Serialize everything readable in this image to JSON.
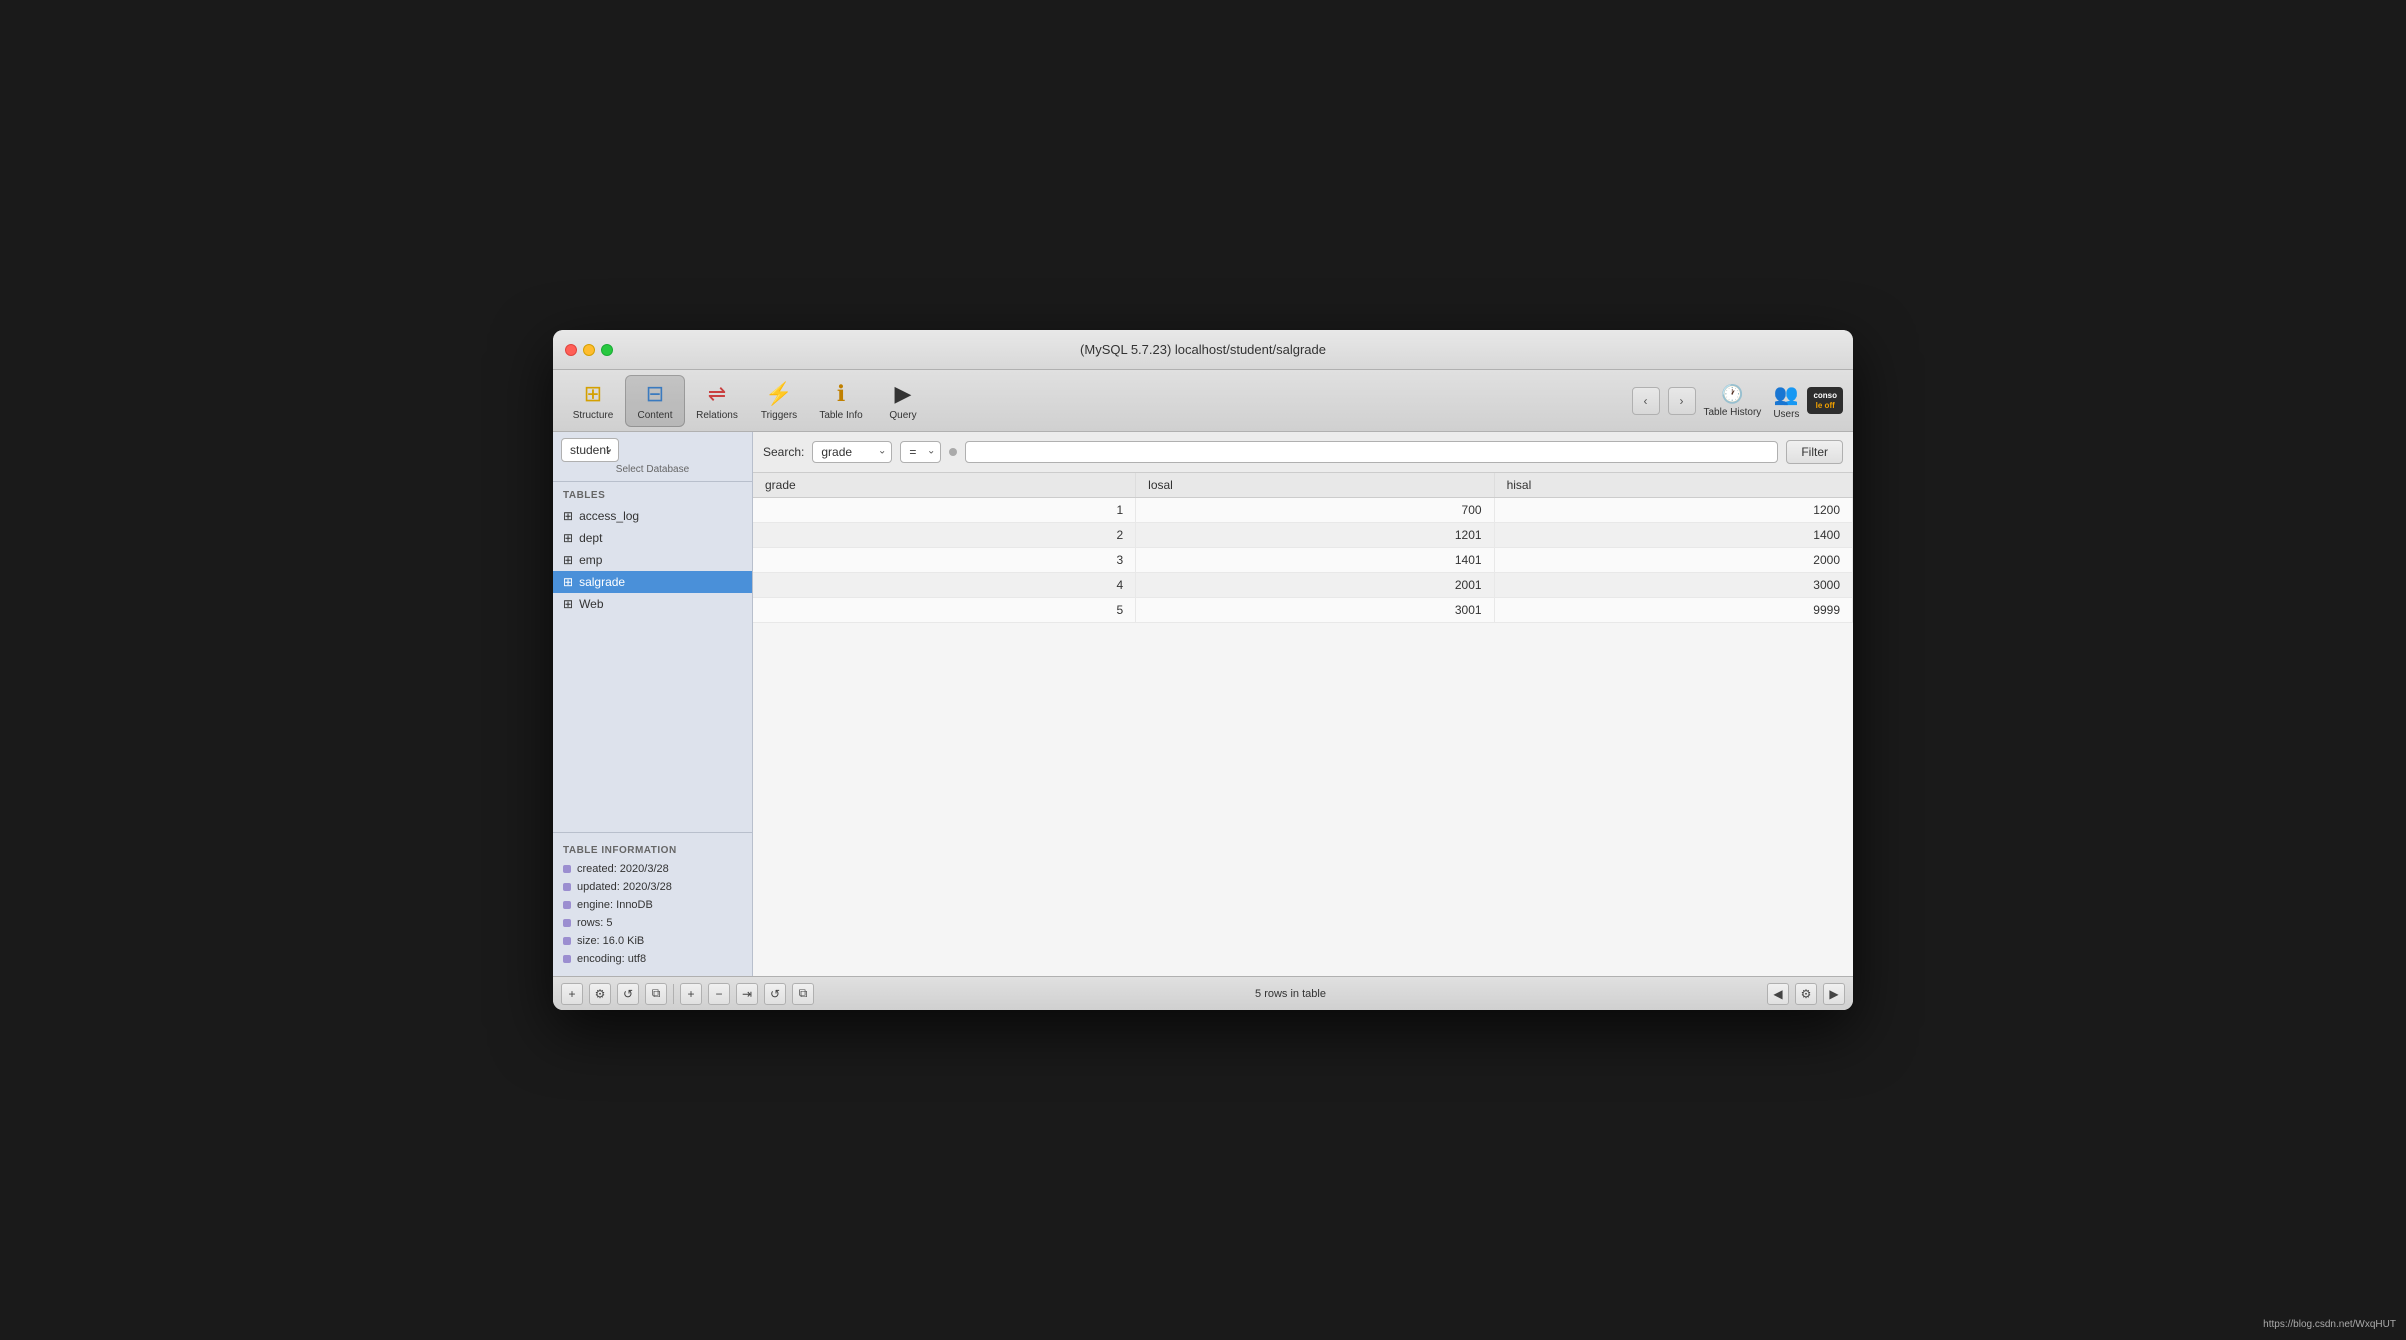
{
  "window": {
    "title": "(MySQL 5.7.23) localhost/student/salgrade",
    "url": "https://blog.csdn.net/WxqHUT"
  },
  "toolbar": {
    "buttons": [
      {
        "id": "structure",
        "label": "Structure",
        "icon": "⊞"
      },
      {
        "id": "content",
        "label": "Content",
        "icon": "⊟"
      },
      {
        "id": "relations",
        "label": "Relations",
        "icon": "⇌"
      },
      {
        "id": "triggers",
        "label": "Triggers",
        "icon": "⚡"
      },
      {
        "id": "tableinfo",
        "label": "Table Info",
        "icon": "ℹ"
      },
      {
        "id": "query",
        "label": "Query",
        "icon": "▶"
      }
    ],
    "table_history_label": "Table History",
    "users_label": "Users",
    "console_label": "Console",
    "console_top": "conso",
    "console_bot": "le off"
  },
  "sidebar": {
    "db_selector": {
      "value": "student",
      "label": "Select Database"
    },
    "tables_heading": "TABLES",
    "tables": [
      {
        "name": "access_log",
        "selected": false
      },
      {
        "name": "dept",
        "selected": false
      },
      {
        "name": "emp",
        "selected": false
      },
      {
        "name": "salgrade",
        "selected": true
      },
      {
        "name": "Web",
        "selected": false
      }
    ],
    "info_heading": "TABLE INFORMATION",
    "info_items": [
      {
        "label": "created: 2020/3/28"
      },
      {
        "label": "updated: 2020/3/28"
      },
      {
        "label": "engine: InnoDB"
      },
      {
        "label": "rows: 5"
      },
      {
        "label": "size: 16.0 KiB"
      },
      {
        "label": "encoding: utf8"
      }
    ]
  },
  "search": {
    "label": "Search:",
    "field_value": "grade",
    "op_value": "=",
    "input_placeholder": "",
    "filter_label": "Filter"
  },
  "table": {
    "columns": [
      "grade",
      "losal",
      "hisal"
    ],
    "rows": [
      [
        "1",
        "700",
        "1200"
      ],
      [
        "2",
        "1201",
        "1400"
      ],
      [
        "3",
        "1401",
        "2000"
      ],
      [
        "4",
        "2001",
        "3000"
      ],
      [
        "5",
        "3001",
        "9999"
      ]
    ]
  },
  "bottom": {
    "status": "5 rows in table",
    "add_label": "+",
    "remove_label": "−",
    "spread_label": "⇥",
    "refresh_label": "↺",
    "copy_label": "⧉",
    "settings_label": "⚙",
    "nav_left": "◀",
    "nav_right": "▶"
  }
}
